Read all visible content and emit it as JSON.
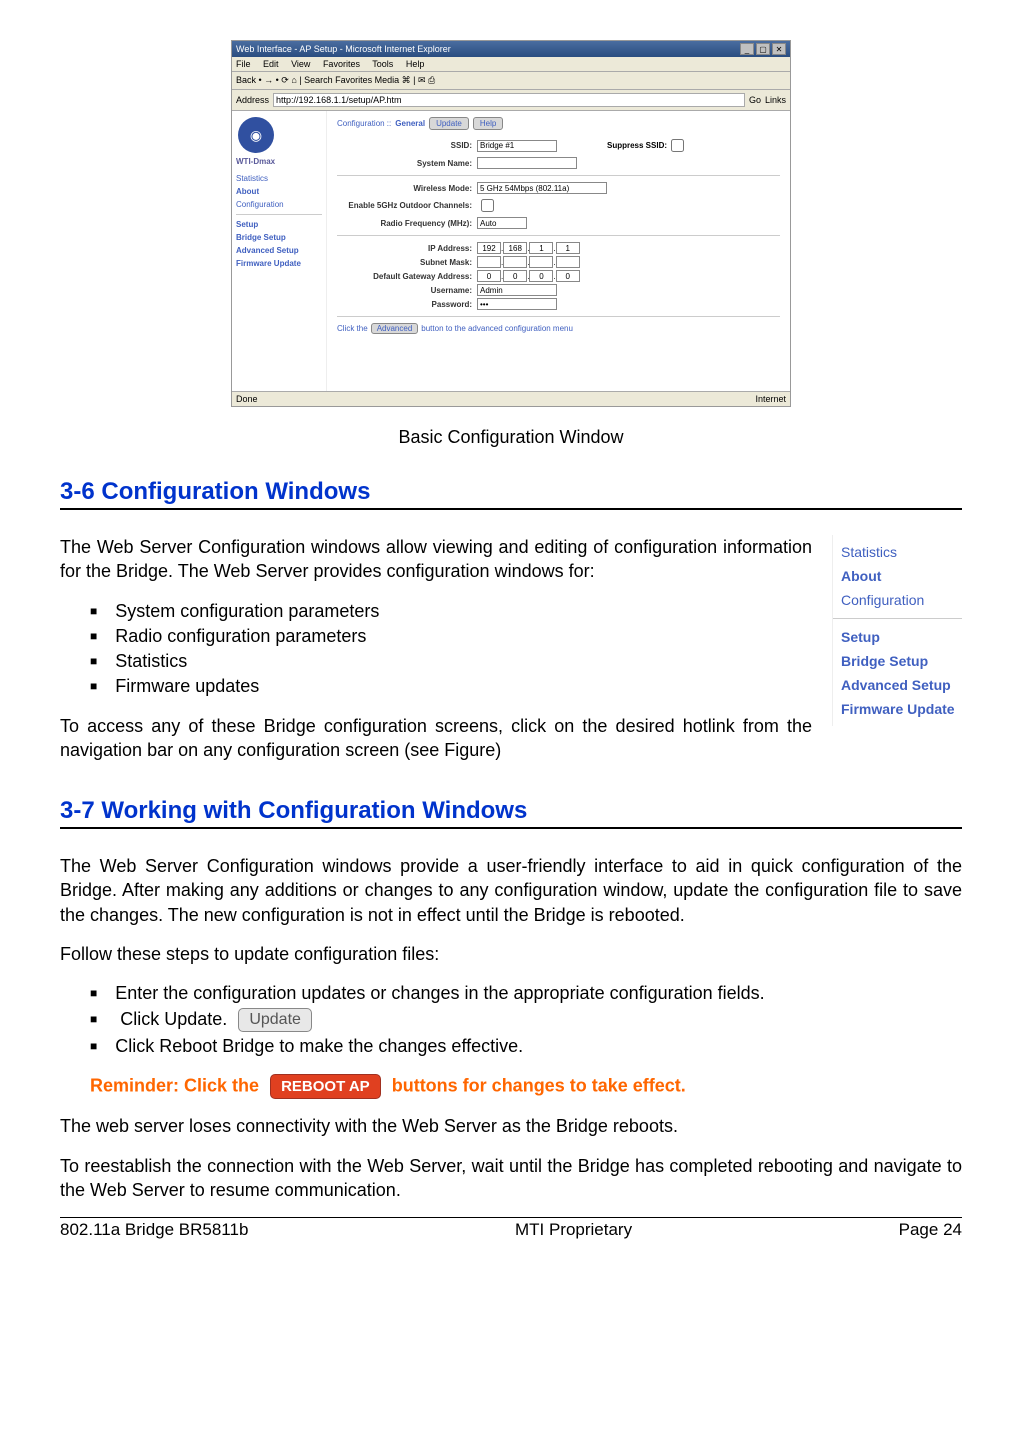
{
  "ie_window": {
    "title": "Web Interface - AP Setup - Microsoft Internet Explorer",
    "menu": [
      "File",
      "Edit",
      "View",
      "Favorites",
      "Tools",
      "Help"
    ],
    "toolbar": "Back • → • ⟳ ⌂ | Search Favorites Media ⌘ | ✉ ⎙",
    "address_label": "Address",
    "address_value": "http://192.168.1.1/setup/AP.htm",
    "go_label": "Go",
    "links_label": "Links",
    "sidebar": {
      "title": "WTI-Dmax",
      "items": [
        "Statistics",
        "About",
        "Configuration"
      ],
      "items2": [
        "Setup",
        "Bridge Setup",
        "Advanced Setup",
        "Firmware Update"
      ]
    },
    "main": {
      "crumb_prefix": "Configuration ::",
      "crumb_current": "General",
      "update_btn": "Update",
      "help_btn": "Help",
      "fields": {
        "ssid_label": "SSID:",
        "ssid_value": "Bridge #1",
        "suppress_label": "Suppress SSID:",
        "sysname_label": "System Name:",
        "wmode_label": "Wireless Mode:",
        "wmode_value": "5 GHz 54Mbps (802.11a)",
        "outdoor_label": "Enable 5GHz Outdoor Channels:",
        "radio_label": "Radio Frequency (MHz):",
        "radio_value": "Auto",
        "ip_label": "IP Address:",
        "ip": [
          "192",
          "168",
          "1",
          "1"
        ],
        "subnet_label": "Subnet Mask:",
        "gateway_label": "Default Gateway Address:",
        "gw": [
          "0",
          "0",
          "0",
          "0"
        ],
        "user_label": "Username:",
        "user_value": "Admin",
        "pass_label": "Password:",
        "pass_value": "•••"
      },
      "advanced_note_pre": "Click the",
      "advanced_btn": "Advanced",
      "advanced_note_post": "button to the advanced configuration menu"
    },
    "status_left": "Done",
    "status_right": "Internet"
  },
  "caption": "Basic Configuration Window",
  "section36": {
    "heading": "3-6 Configuration Windows",
    "para1": "The Web Server Configuration windows allow viewing and editing of configuration information for the Bridge. The Web Server provides configuration windows for:",
    "bullets": [
      "System configuration parameters",
      "Radio configuration parameters",
      "Statistics",
      "Firmware updates"
    ],
    "para2": "To access any of these Bridge configuration screens, click on the desired hotlink from the navigation bar on any configuration screen (see Figure)",
    "navbar": {
      "top": [
        "Statistics",
        "About",
        "Configuration"
      ],
      "bottom": [
        "Setup",
        "Bridge Setup",
        "Advanced Setup",
        "Firmware Update"
      ]
    }
  },
  "section37": {
    "heading": "3-7 Working with Configuration Windows",
    "para1": "The Web Server Configuration windows provide a user-friendly interface to aid in quick configuration of the Bridge. After making any additions or changes to any configuration window, update the configuration file to save the changes. The new configuration is not in effect until the Bridge is rebooted.",
    "para2": "Follow these steps to update configuration files:",
    "bullets": [
      "Enter the configuration updates or changes in the appropriate configuration fields.",
      "Click Update.",
      "Click Reboot Bridge to make the changes effective."
    ],
    "update_btn": "Update",
    "reminder_pre": "Reminder: Click the",
    "reboot_btn": "REBOOT AP",
    "reminder_post": "buttons for changes to take effect.",
    "para3": "The web server loses connectivity with the Web Server as the Bridge reboots.",
    "para4": "To reestablish the connection with the Web Server, wait until the Bridge has completed rebooting and navigate to the Web Server to resume communication."
  },
  "footer": {
    "left": "802.11a Bridge  BR5811b",
    "center": "MTI Proprietary",
    "right": "Page 24"
  }
}
